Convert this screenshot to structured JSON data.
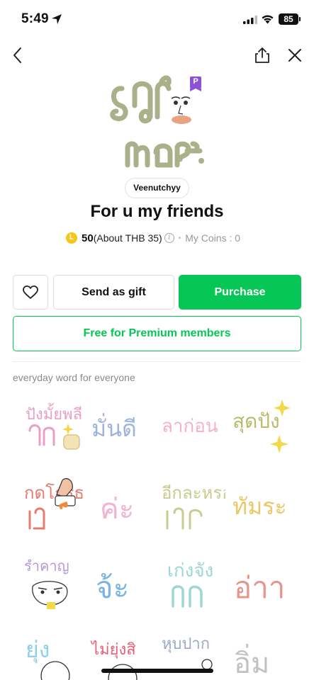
{
  "status_bar": {
    "time": "5:49",
    "battery": "85"
  },
  "nav": {
    "back_icon": "chevron-left-icon",
    "share_icon": "share-icon",
    "close_icon": "close-icon"
  },
  "premium_badge": "P",
  "author": "Veenutchyy",
  "title": "For u my friends",
  "price": {
    "coin_letter": "L",
    "value": "50",
    "approx": "(About THB 35)",
    "info": "i",
    "separator": "•",
    "my_coins": "My Coins : 0"
  },
  "buttons": {
    "send_gift": "Send as gift",
    "purchase": "Purchase",
    "premium": "Free for Premium members"
  },
  "description": "everyday word for everyone",
  "colors": {
    "line_green": "#06c755",
    "premium_purple": "#8b52d8",
    "coin": "#f5c518"
  },
  "stickers": [
    "ปังมั้ยพลี",
    "มั่นดี",
    "ลาก่อน",
    "สุดปัง",
    "กดโกรธ",
    "ค่ะ",
    "อีกละหรอ",
    "ทัมระ",
    "รำคาญ",
    "จ้ะ",
    "เก่งจัง",
    "อ่าา",
    "ยุ่ง",
    "ไม่ยุ่งสิ",
    "หุบปาก",
    "อิ่ม"
  ]
}
